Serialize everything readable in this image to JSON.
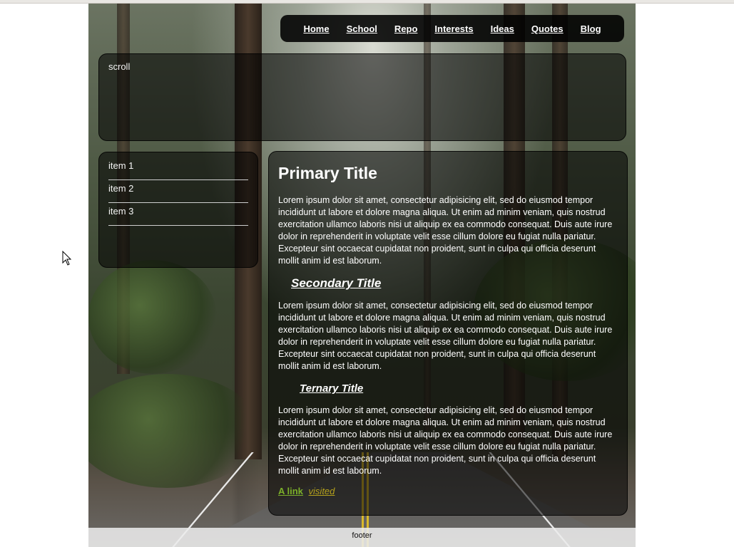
{
  "nav": {
    "items": [
      "Home",
      "School",
      "Repo",
      "Interests",
      "Ideas",
      "Quotes",
      "Blog"
    ]
  },
  "scroll_panel": {
    "text": "scroll"
  },
  "sidebar": {
    "items": [
      "item 1",
      "item 2",
      "item 3"
    ]
  },
  "content": {
    "primary_title": "Primary Title",
    "paragraph_1": "Lorem ipsum dolor sit amet, consectetur adipisicing elit, sed do eiusmod tempor incididunt ut labore et dolore magna aliqua. Ut enim ad minim veniam, quis nostrud exercitation ullamco laboris nisi ut aliquip ex ea commodo consequat. Duis aute irure dolor in reprehenderit in voluptate velit esse cillum dolore eu fugiat nulla pariatur. Excepteur sint occaecat cupidatat non proident, sunt in culpa qui officia deserunt mollit anim id est laborum.",
    "secondary_title": "Secondary Title",
    "paragraph_2": "Lorem ipsum dolor sit amet, consectetur adipisicing elit, sed do eiusmod tempor incididunt ut labore et dolore magna aliqua. Ut enim ad minim veniam, quis nostrud exercitation ullamco laboris nisi ut aliquip ex ea commodo consequat. Duis aute irure dolor in reprehenderit in voluptate velit esse cillum dolore eu fugiat nulla pariatur. Excepteur sint occaecat cupidatat non proident, sunt in culpa qui officia deserunt mollit anim id est laborum.",
    "ternary_title": "Ternary Title",
    "paragraph_3": "Lorem ipsum dolor sit amet, consectetur adipisicing elit, sed do eiusmod tempor incididunt ut labore et dolore magna aliqua. Ut enim ad minim veniam, quis nostrud exercitation ullamco laboris nisi ut aliquip ex ea commodo consequat. Duis aute irure dolor in reprehenderit in voluptate velit esse cillum dolore eu fugiat nulla pariatur. Excepteur sint occaecat cupidatat non proident, sunt in culpa qui officia deserunt mollit anim id est laborum.",
    "link_label": "A link",
    "visited_label": "visited"
  },
  "footer": {
    "text": "footer"
  },
  "colors": {
    "link": "#7bb02a",
    "visited": "#b6a21c",
    "panel_bg": "rgba(0,0,0,0.55)"
  },
  "icons": {
    "cursor": "arrow-cursor-icon"
  }
}
